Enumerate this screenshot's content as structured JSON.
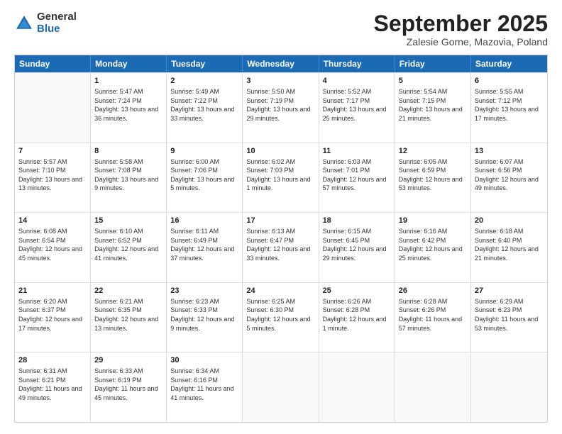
{
  "logo": {
    "general": "General",
    "blue": "Blue"
  },
  "title": "September 2025",
  "subtitle": "Zalesie Gorne, Mazovia, Poland",
  "days": [
    "Sunday",
    "Monday",
    "Tuesday",
    "Wednesday",
    "Thursday",
    "Friday",
    "Saturday"
  ],
  "weeks": [
    [
      {
        "day": "",
        "empty": true
      },
      {
        "day": "1",
        "sunrise": "Sunrise: 5:47 AM",
        "sunset": "Sunset: 7:24 PM",
        "daylight": "Daylight: 13 hours and 36 minutes."
      },
      {
        "day": "2",
        "sunrise": "Sunrise: 5:49 AM",
        "sunset": "Sunset: 7:22 PM",
        "daylight": "Daylight: 13 hours and 33 minutes."
      },
      {
        "day": "3",
        "sunrise": "Sunrise: 5:50 AM",
        "sunset": "Sunset: 7:19 PM",
        "daylight": "Daylight: 13 hours and 29 minutes."
      },
      {
        "day": "4",
        "sunrise": "Sunrise: 5:52 AM",
        "sunset": "Sunset: 7:17 PM",
        "daylight": "Daylight: 13 hours and 25 minutes."
      },
      {
        "day": "5",
        "sunrise": "Sunrise: 5:54 AM",
        "sunset": "Sunset: 7:15 PM",
        "daylight": "Daylight: 13 hours and 21 minutes."
      },
      {
        "day": "6",
        "sunrise": "Sunrise: 5:55 AM",
        "sunset": "Sunset: 7:12 PM",
        "daylight": "Daylight: 13 hours and 17 minutes."
      }
    ],
    [
      {
        "day": "7",
        "sunrise": "Sunrise: 5:57 AM",
        "sunset": "Sunset: 7:10 PM",
        "daylight": "Daylight: 13 hours and 13 minutes."
      },
      {
        "day": "8",
        "sunrise": "Sunrise: 5:58 AM",
        "sunset": "Sunset: 7:08 PM",
        "daylight": "Daylight: 13 hours and 9 minutes."
      },
      {
        "day": "9",
        "sunrise": "Sunrise: 6:00 AM",
        "sunset": "Sunset: 7:06 PM",
        "daylight": "Daylight: 13 hours and 5 minutes."
      },
      {
        "day": "10",
        "sunrise": "Sunrise: 6:02 AM",
        "sunset": "Sunset: 7:03 PM",
        "daylight": "Daylight: 13 hours and 1 minute."
      },
      {
        "day": "11",
        "sunrise": "Sunrise: 6:03 AM",
        "sunset": "Sunset: 7:01 PM",
        "daylight": "Daylight: 12 hours and 57 minutes."
      },
      {
        "day": "12",
        "sunrise": "Sunrise: 6:05 AM",
        "sunset": "Sunset: 6:59 PM",
        "daylight": "Daylight: 12 hours and 53 minutes."
      },
      {
        "day": "13",
        "sunrise": "Sunrise: 6:07 AM",
        "sunset": "Sunset: 6:56 PM",
        "daylight": "Daylight: 12 hours and 49 minutes."
      }
    ],
    [
      {
        "day": "14",
        "sunrise": "Sunrise: 6:08 AM",
        "sunset": "Sunset: 6:54 PM",
        "daylight": "Daylight: 12 hours and 45 minutes."
      },
      {
        "day": "15",
        "sunrise": "Sunrise: 6:10 AM",
        "sunset": "Sunset: 6:52 PM",
        "daylight": "Daylight: 12 hours and 41 minutes."
      },
      {
        "day": "16",
        "sunrise": "Sunrise: 6:11 AM",
        "sunset": "Sunset: 6:49 PM",
        "daylight": "Daylight: 12 hours and 37 minutes."
      },
      {
        "day": "17",
        "sunrise": "Sunrise: 6:13 AM",
        "sunset": "Sunset: 6:47 PM",
        "daylight": "Daylight: 12 hours and 33 minutes."
      },
      {
        "day": "18",
        "sunrise": "Sunrise: 6:15 AM",
        "sunset": "Sunset: 6:45 PM",
        "daylight": "Daylight: 12 hours and 29 minutes."
      },
      {
        "day": "19",
        "sunrise": "Sunrise: 6:16 AM",
        "sunset": "Sunset: 6:42 PM",
        "daylight": "Daylight: 12 hours and 25 minutes."
      },
      {
        "day": "20",
        "sunrise": "Sunrise: 6:18 AM",
        "sunset": "Sunset: 6:40 PM",
        "daylight": "Daylight: 12 hours and 21 minutes."
      }
    ],
    [
      {
        "day": "21",
        "sunrise": "Sunrise: 6:20 AM",
        "sunset": "Sunset: 6:37 PM",
        "daylight": "Daylight: 12 hours and 17 minutes."
      },
      {
        "day": "22",
        "sunrise": "Sunrise: 6:21 AM",
        "sunset": "Sunset: 6:35 PM",
        "daylight": "Daylight: 12 hours and 13 minutes."
      },
      {
        "day": "23",
        "sunrise": "Sunrise: 6:23 AM",
        "sunset": "Sunset: 6:33 PM",
        "daylight": "Daylight: 12 hours and 9 minutes."
      },
      {
        "day": "24",
        "sunrise": "Sunrise: 6:25 AM",
        "sunset": "Sunset: 6:30 PM",
        "daylight": "Daylight: 12 hours and 5 minutes."
      },
      {
        "day": "25",
        "sunrise": "Sunrise: 6:26 AM",
        "sunset": "Sunset: 6:28 PM",
        "daylight": "Daylight: 12 hours and 1 minute."
      },
      {
        "day": "26",
        "sunrise": "Sunrise: 6:28 AM",
        "sunset": "Sunset: 6:26 PM",
        "daylight": "Daylight: 11 hours and 57 minutes."
      },
      {
        "day": "27",
        "sunrise": "Sunrise: 6:29 AM",
        "sunset": "Sunset: 6:23 PM",
        "daylight": "Daylight: 11 hours and 53 minutes."
      }
    ],
    [
      {
        "day": "28",
        "sunrise": "Sunrise: 6:31 AM",
        "sunset": "Sunset: 6:21 PM",
        "daylight": "Daylight: 11 hours and 49 minutes."
      },
      {
        "day": "29",
        "sunrise": "Sunrise: 6:33 AM",
        "sunset": "Sunset: 6:19 PM",
        "daylight": "Daylight: 11 hours and 45 minutes."
      },
      {
        "day": "30",
        "sunrise": "Sunrise: 6:34 AM",
        "sunset": "Sunset: 6:16 PM",
        "daylight": "Daylight: 11 hours and 41 minutes."
      },
      {
        "day": "",
        "empty": true
      },
      {
        "day": "",
        "empty": true
      },
      {
        "day": "",
        "empty": true
      },
      {
        "day": "",
        "empty": true
      }
    ]
  ]
}
